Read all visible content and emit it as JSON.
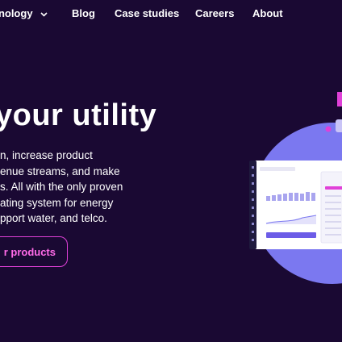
{
  "nav": {
    "technology_label": "hnology",
    "technology_chevron": "chevron-down-icon",
    "blog_label": "Blog",
    "case_studies_label": "Case studies",
    "careers_label": "Careers",
    "about_label": "About"
  },
  "hero": {
    "headline": "your utility",
    "body_lines": [
      "n, increase product",
      "enue streams, and make",
      "s. All with the only proven",
      "ating system for energy",
      "pport water, and telco."
    ],
    "cta_label": "r products"
  },
  "colors": {
    "background": "#1a0933",
    "accent_pink": "#e040d8",
    "illustration_circle": "#7b78f0",
    "dashboard_bar": "#6c5ce7"
  }
}
